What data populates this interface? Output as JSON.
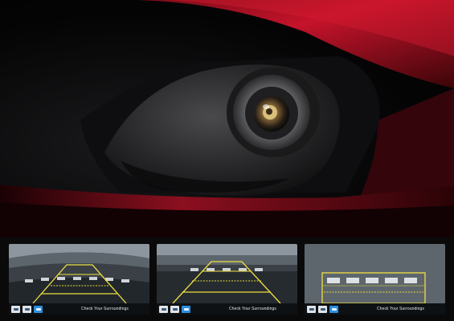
{
  "hero": {
    "camera_icon": "rear-camera-lens",
    "colors": {
      "body_red": "#c4132a",
      "trim_dark": "#141416"
    }
  },
  "screens": [
    {
      "status_text": "Check Your Surroundings",
      "view": "wide",
      "active_button": 2
    },
    {
      "status_text": "Check Your Surroundings",
      "view": "normal",
      "active_button": 2
    },
    {
      "status_text": "Check Your Surroundings",
      "view": "top-down",
      "active_button": 2
    }
  ],
  "buttons": [
    {
      "icon": "wide-view-icon"
    },
    {
      "icon": "normal-view-icon"
    },
    {
      "icon": "top-down-view-icon"
    }
  ],
  "guide_colors": {
    "outer": "#f0e040",
    "inner": "#e6d83a"
  }
}
